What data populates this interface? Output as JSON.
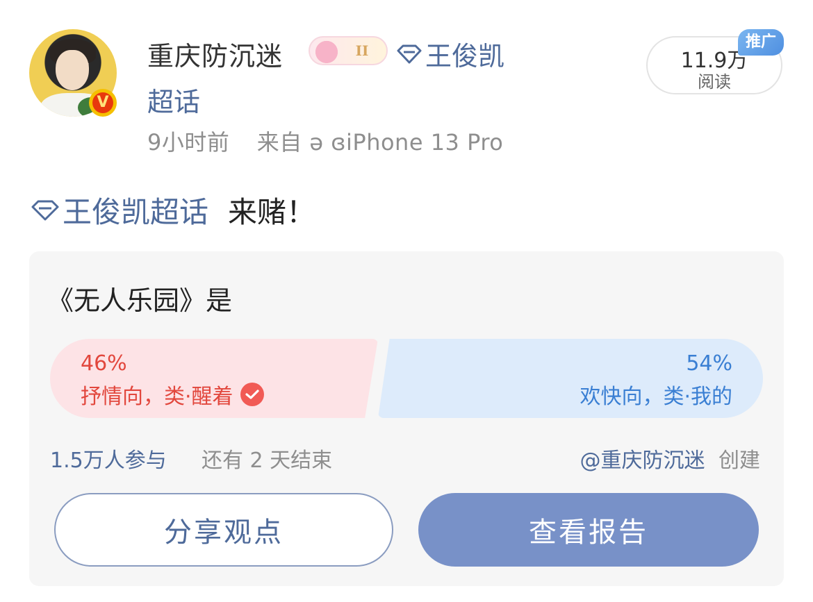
{
  "post": {
    "author": "重庆防沉迷",
    "medal_level": "II",
    "supertopic_link": "王俊凯",
    "supertopic_link_2": "超话",
    "time": "9小时前",
    "source": "来自 ə ɞiPhone 13 Pro",
    "reads_value": "11.9万",
    "reads_label": "阅读",
    "promo_badge": "推广",
    "topic_tag": "王俊凯超话",
    "content": "来赌！"
  },
  "vote": {
    "question": "《无人乐园》是",
    "option_a": {
      "percent": "46%",
      "label": "抒情向，类·醒着",
      "selected": true
    },
    "option_b": {
      "percent": "54%",
      "label": "欢快向，类·我的",
      "selected": false
    },
    "participants": "1.5万人参与",
    "remaining": "还有 2 天结束",
    "creator_name": "@重庆防沉迷",
    "creator_suffix": "创建",
    "share_button": "分享观点",
    "report_button": "查看报告"
  },
  "colors": {
    "link": "#4e6a9a",
    "option_a": "#e2473d",
    "option_b": "#3a7fd3",
    "primary_button": "#7891c8"
  },
  "icons": {
    "verified": "v-badge-icon",
    "supertopic": "diamond-icon",
    "selected": "check-circle-icon"
  }
}
